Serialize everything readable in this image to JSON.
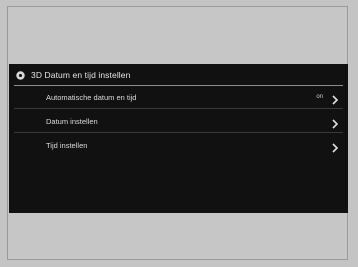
{
  "screen": {
    "title": "3D Datum en tijd instellen",
    "header_icon": "gear-icon",
    "items": [
      {
        "label": "Automatische datum en tijd",
        "value": "on",
        "icon": "chevron-right-icon"
      },
      {
        "label": "Datum instellen",
        "value": "",
        "icon": "chevron-right-icon"
      },
      {
        "label": "Tijd instellen",
        "value": "",
        "icon": "chevron-right-icon"
      }
    ]
  },
  "colors": {
    "page_bg": "#c4c4c4",
    "screen_bg": "#111111",
    "text": "#e6e6e6",
    "divider": "#8d8d8d"
  }
}
